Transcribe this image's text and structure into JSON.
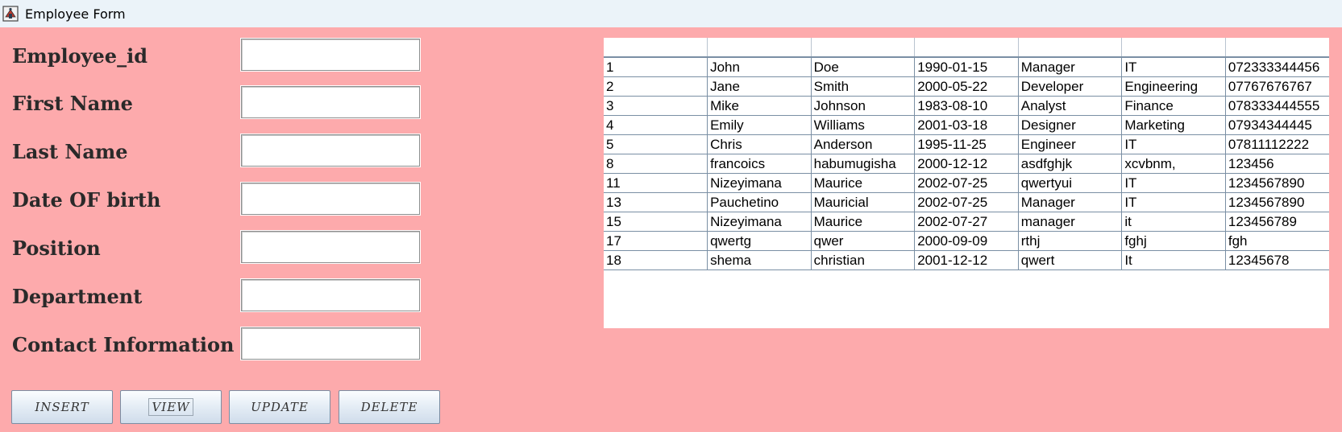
{
  "window": {
    "title": "Employee Form",
    "icon": "java-app-icon"
  },
  "form": {
    "fields": [
      {
        "label": "Employee_id",
        "value": ""
      },
      {
        "label": "First Name",
        "value": ""
      },
      {
        "label": "Last Name",
        "value": ""
      },
      {
        "label": "Date OF birth",
        "value": ""
      },
      {
        "label": "Position",
        "value": ""
      },
      {
        "label": "Department",
        "value": ""
      },
      {
        "label": "Contact Information",
        "value": ""
      }
    ]
  },
  "buttons": {
    "insert": "INSERT",
    "view": "VIEW",
    "update": "UPDATE",
    "delete": "DELETE"
  },
  "table": {
    "headers": [
      "",
      "",
      "",
      "",
      "",
      "",
      ""
    ],
    "rows": [
      [
        "1",
        "John",
        "Doe",
        "1990-01-15",
        "Manager",
        "IT",
        "072333344456"
      ],
      [
        "2",
        "Jane",
        "Smith",
        "2000-05-22",
        "Developer",
        "Engineering",
        "07767676767"
      ],
      [
        "3",
        "Mike",
        "Johnson",
        "1983-08-10",
        "Analyst",
        "Finance",
        "078333444555"
      ],
      [
        "4",
        "Emily",
        "Williams",
        "2001-03-18",
        "Designer",
        "Marketing",
        "07934344445"
      ],
      [
        "5",
        "Chris",
        "Anderson",
        "1995-11-25",
        "Engineer",
        "IT",
        "07811112222"
      ],
      [
        "8",
        "francoics",
        "habumugisha",
        "2000-12-12",
        "asdfghjk",
        "xcvbnm,",
        "123456"
      ],
      [
        "11",
        "Nizeyimana",
        "Maurice",
        "2002-07-25",
        "qwertyui",
        "IT",
        "1234567890"
      ],
      [
        "13",
        "Pauchetino",
        "Mauricial",
        "2002-07-25",
        "Manager",
        "IT",
        "1234567890"
      ],
      [
        "15",
        "Nizeyimana",
        "Maurice",
        "2002-07-27",
        "manager",
        "it",
        "123456789"
      ],
      [
        "17",
        "qwertg",
        "qwer",
        "2000-09-09",
        "rthj",
        "fghj",
        "fgh"
      ],
      [
        "18",
        "shema",
        "christian",
        "2001-12-12",
        "qwert",
        "It",
        "12345678"
      ]
    ]
  },
  "colors": {
    "background": "#FDAAAC",
    "titlebar": "#EBF3F9",
    "grid_line": "#7A8FA4"
  }
}
